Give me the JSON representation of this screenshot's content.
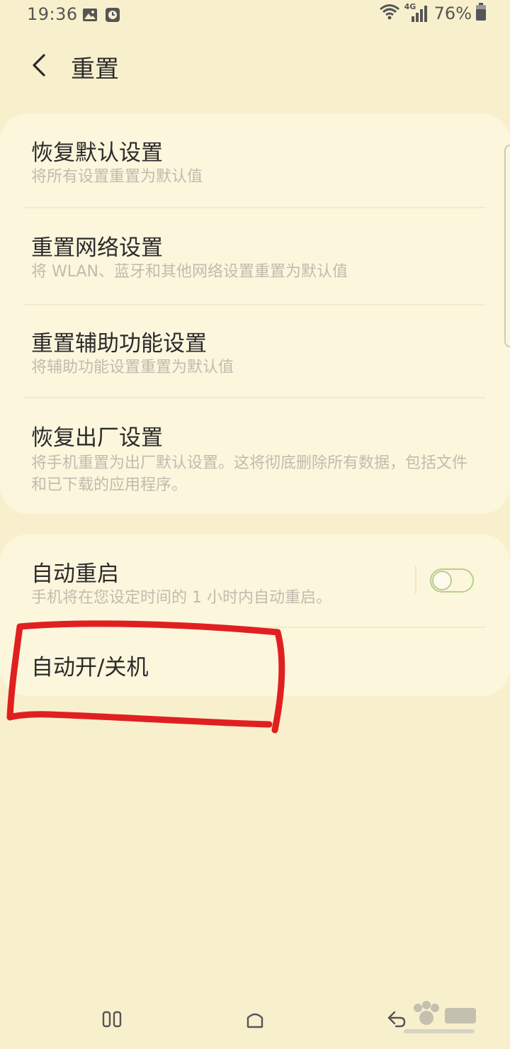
{
  "status_bar": {
    "time": "19:36",
    "left_icons": [
      "image-icon",
      "clock-notification-icon"
    ],
    "right_icons": [
      "wifi-icon",
      "4g-signal-icon",
      "battery-icon"
    ],
    "network_label": "4G",
    "battery_text": "76%"
  },
  "header": {
    "title": "重置",
    "back_icon": "chevron-left-icon"
  },
  "sections": [
    {
      "items": [
        {
          "title": "恢复默认设置",
          "subtitle": "将所有设置重置为默认值"
        },
        {
          "title": "重置网络设置",
          "subtitle": "将 WLAN、蓝牙和其他网络设置重置为默认值"
        },
        {
          "title": "重置辅助功能设置",
          "subtitle": "将辅助功能设置重置为默认值"
        },
        {
          "title": "恢复出厂设置",
          "subtitle": "将手机重置为出厂默认设置。这将彻底删除所有数据，包括文件和已下载的应用程序。"
        }
      ]
    },
    {
      "items": [
        {
          "title": "自动重启",
          "subtitle": "手机将在您设定时间的 1 小时内自动重启。",
          "toggle_on": false
        },
        {
          "title": "自动开/关机"
        }
      ]
    }
  ],
  "annotation": {
    "color": "#e02020",
    "target": "自动开/关机"
  },
  "nav_bar": {
    "icons": [
      "recent-apps-icon",
      "home-icon",
      "back-icon"
    ]
  },
  "colors": {
    "background": "#f8f0cd",
    "card": "#fcf6dd",
    "title_text": "#2b2b2b",
    "subtitle_text": "#c0bcae",
    "toggle_accent": "#b8d08a"
  }
}
